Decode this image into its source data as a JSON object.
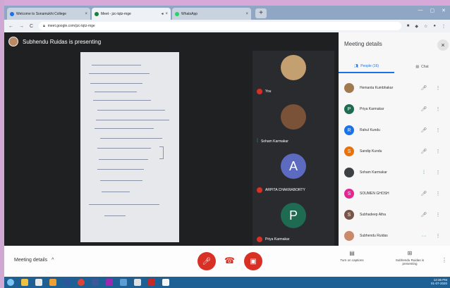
{
  "browser": {
    "tabs": [
      {
        "label": "Welcome to Sonamukhi College",
        "favicon_color": "#1a73e8",
        "active": false
      },
      {
        "label": "Meet - jzc-tqtz-mge",
        "favicon_color": "#188038",
        "active": true
      },
      {
        "label": "WhatsApp",
        "favicon_color": "#25d366",
        "active": false
      }
    ],
    "url": "meet.google.com/jzc-tqtz-mge"
  },
  "meet": {
    "presenter_text": "Subhendu Ruidas is presenting"
  },
  "tiles": [
    {
      "name": "You",
      "kind": "photo",
      "mic": "off",
      "photo_color": "#c4a070"
    },
    {
      "name": "Soham Karmakar",
      "kind": "photo",
      "mic": "on",
      "photo_color": "#7a5238"
    },
    {
      "name": "ARPITA CHAKRABORTY",
      "kind": "letter",
      "letter": "A",
      "color": "#5c6bc0",
      "mic": "off"
    },
    {
      "name": "Priya Karmakar",
      "kind": "letter",
      "letter": "P",
      "color": "#1e6b52",
      "mic": "off"
    }
  ],
  "panel": {
    "title": "Meeting details",
    "tabs": [
      {
        "label": "People (16)",
        "icon": "people-icon"
      },
      {
        "label": "Chat",
        "icon": "chat-icon"
      }
    ],
    "people": [
      {
        "name": "Hemanta Kumbhakar",
        "initial": "",
        "color": "#a0794f",
        "status": "muted"
      },
      {
        "name": "Priya Karmakar",
        "initial": "P",
        "color": "#1e6b52",
        "status": "muted"
      },
      {
        "name": "Rahul Kundu",
        "initial": "R",
        "color": "#1a73e8",
        "status": "muted"
      },
      {
        "name": "Sandip Kundu",
        "initial": "S",
        "color": "#e8710a",
        "status": "muted"
      },
      {
        "name": "Soham Karmakar",
        "initial": "",
        "color": "#3c4043",
        "status": "speaking"
      },
      {
        "name": "SOUMEN GHOSH",
        "initial": "S",
        "color": "#e52592",
        "status": "muted"
      },
      {
        "name": "Subhadeep Atha",
        "initial": "S",
        "color": "#795548",
        "status": "muted"
      },
      {
        "name": "Subhendu Ruidas",
        "initial": "",
        "color": "#c98a6a",
        "status": "presenting"
      }
    ]
  },
  "bottom": {
    "meeting_details_label": "Meeting details",
    "captions_label": "Turn on captions",
    "presenting_label": "Subhendu Ruidas is presenting"
  },
  "taskbar": {
    "time": "12:36 PM",
    "date": "01-07-2020"
  }
}
